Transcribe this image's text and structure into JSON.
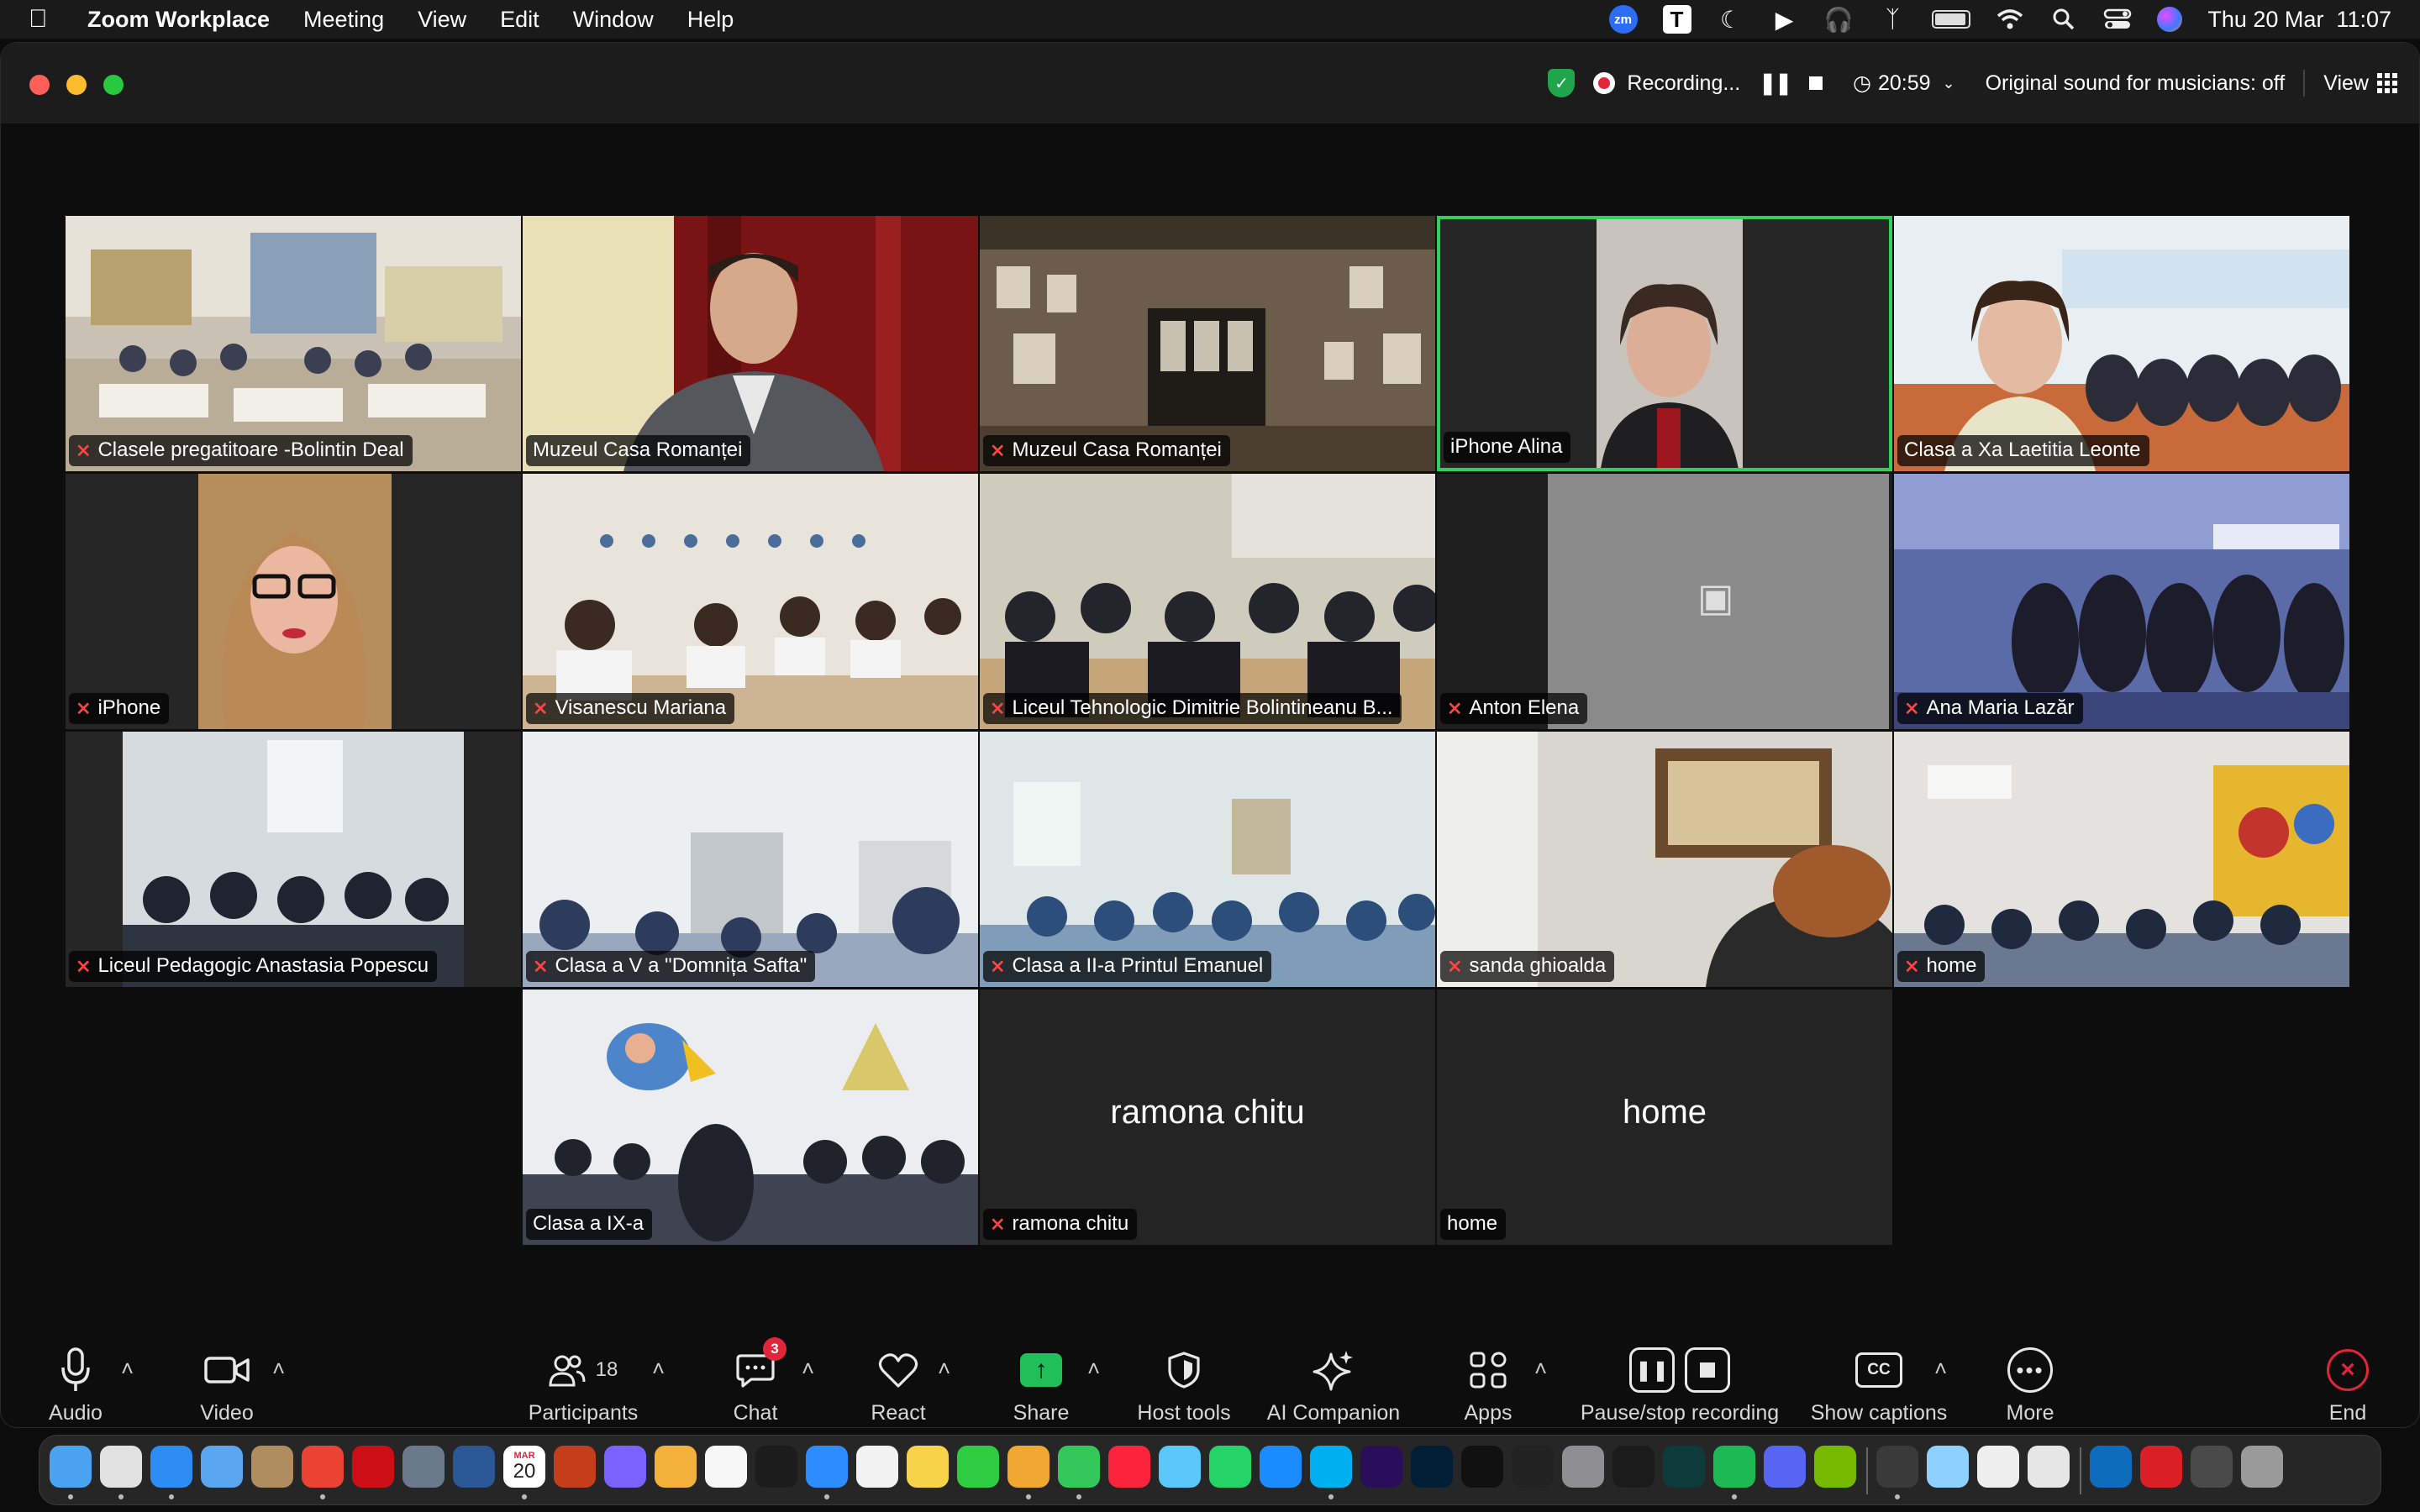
{
  "menubar": {
    "app_name": "Zoom Workplace",
    "menus": [
      "Meeting",
      "View",
      "Edit",
      "Window",
      "Help"
    ],
    "zoom_badge": "zm",
    "t_badge": "T",
    "clock": "Thu 20 Mar  11:07",
    "icons": [
      "apple-icon",
      "zoom-status-icon",
      "t-app-icon",
      "moon-icon",
      "play-icon",
      "headphones-icon",
      "bluetooth-icon",
      "battery-icon",
      "wifi-icon",
      "search-icon",
      "control-center-icon",
      "siri-icon"
    ]
  },
  "titlebar": {
    "recording_label": "Recording...",
    "timer": "20:59",
    "original_sound": "Original sound for musicians: off",
    "view_label": "View",
    "colors": {
      "secure": "#1fa64c",
      "record": "#e0263a"
    }
  },
  "tiles": [
    {
      "name": "Clasele pregatitoare -Bolintin Deal",
      "muted": true,
      "scene": "classroom"
    },
    {
      "name": "Muzeul Casa Romanței",
      "muted": false,
      "scene": "man-red-curtain"
    },
    {
      "name": "Muzeul Casa Romanței",
      "muted": true,
      "scene": "ornate-hall"
    },
    {
      "name": "iPhone Alina",
      "muted": false,
      "scene": "woman-speaking",
      "active": true
    },
    {
      "name": "Clasa a Xa Laetitia Leonte",
      "muted": false,
      "scene": "classroom-teacher"
    },
    {
      "name": "iPhone",
      "muted": true,
      "scene": "woman-glasses"
    },
    {
      "name": "Visanescu Mariana",
      "muted": true,
      "scene": "classroom"
    },
    {
      "name": "Liceul Tehnologic Dimitrie Bolintineanu B...",
      "muted": true,
      "scene": "classroom-dark"
    },
    {
      "name": "Anton Elena",
      "muted": true,
      "scene": "camera-off"
    },
    {
      "name": "Ana Maria Lazăr",
      "muted": true,
      "scene": "classroom-blue"
    },
    {
      "name": "Liceul Pedagogic Anastasia Popescu",
      "muted": true,
      "scene": "classroom-dark"
    },
    {
      "name": "Clasa a V a \"Domnița Safta\"",
      "muted": true,
      "scene": "classroom-bright"
    },
    {
      "name": "Clasa a II-a Printul Emanuel",
      "muted": true,
      "scene": "classroom-bright"
    },
    {
      "name": "sanda ghioalda",
      "muted": true,
      "scene": "room-painting"
    },
    {
      "name": "home",
      "muted": true,
      "scene": "classroom-colorful"
    },
    {
      "name": "Clasa a IX-a",
      "muted": false,
      "scene": "classroom-mural"
    },
    {
      "name": "ramona chitu",
      "muted": true,
      "scene": "no-video",
      "display": "ramona chitu"
    },
    {
      "name": "home",
      "muted": false,
      "scene": "no-video",
      "display": "home"
    }
  ],
  "controls": {
    "audio": "Audio",
    "video": "Video",
    "participants": "Participants",
    "participant_count": "18",
    "chat": "Chat",
    "chat_badge": "3",
    "react": "React",
    "share": "Share",
    "host_tools": "Host tools",
    "ai_companion": "AI Companion",
    "apps": "Apps",
    "pause_stop": "Pause/stop recording",
    "captions": "Show captions",
    "cc": "CC",
    "more": "More",
    "end": "End"
  },
  "dock": {
    "calendar_month": "MAR",
    "calendar_day": "20",
    "apps": [
      "finder",
      "launchpad",
      "safari",
      "mail",
      "contacts",
      "chrome",
      "opera",
      "preview",
      "word",
      "calendar",
      "powerpoint",
      "siri",
      "keynote",
      "freeform",
      "apple-tv",
      "zoom",
      "reminders",
      "notes",
      "facetime",
      "photos",
      "messages",
      "music",
      "maps",
      "whatsapp",
      "app-store",
      "skype",
      "premiere",
      "photoshop",
      "tiktok",
      "capcut",
      "settings",
      "vectorworks",
      "waves",
      "spotify",
      "discord",
      "nvidia",
      "quicktime",
      "finder-2",
      "textedit",
      "photos-2",
      "onedrive",
      "creative-cloud",
      "screenshots",
      "trash"
    ]
  }
}
